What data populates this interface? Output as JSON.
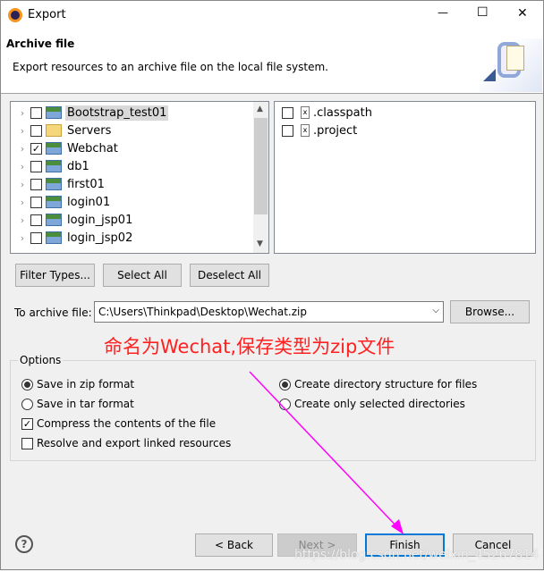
{
  "window": {
    "title": "Export",
    "minimize": "—",
    "maximize": "☐",
    "close": "✕"
  },
  "header": {
    "title": "Archive file",
    "description": "Export resources to an archive file on the local file system."
  },
  "projects": [
    {
      "label": "Bootstrap_test01",
      "checked": false,
      "icon": "java-project-icon",
      "selected": true
    },
    {
      "label": "Servers",
      "checked": false,
      "icon": "folder-icon"
    },
    {
      "label": "Webchat",
      "checked": true,
      "icon": "java-project-icon"
    },
    {
      "label": "db1",
      "checked": false,
      "icon": "java-project-icon"
    },
    {
      "label": "first01",
      "checked": false,
      "icon": "java-project-icon"
    },
    {
      "label": "login01",
      "checked": false,
      "icon": "java-project-icon"
    },
    {
      "label": "login_jsp01",
      "checked": false,
      "icon": "java-project-icon"
    },
    {
      "label": "login_jsp02",
      "checked": false,
      "icon": "java-project-icon"
    }
  ],
  "files": [
    {
      "label": ".classpath",
      "checked": false
    },
    {
      "label": ".project",
      "checked": false
    }
  ],
  "buttons": {
    "filter": "Filter Types...",
    "select_all": "Select All",
    "deselect_all": "Deselect All",
    "browse": "Browse...",
    "back": "< Back",
    "next": "Next >",
    "finish": "Finish",
    "cancel": "Cancel"
  },
  "archive": {
    "label": "To archive file:",
    "value": "C:\\Users\\Thinkpad\\Desktop\\Wechat.zip"
  },
  "annotation": "命名为Wechat,保存类型为zip文件",
  "options": {
    "title": "Options",
    "zip": "Save in zip format",
    "tar": "Save in tar format",
    "compress": "Compress the contents of the file",
    "resolve": "Resolve and export linked resources",
    "dir_structure": "Create directory structure for files",
    "selected_dirs": "Create only selected directories"
  },
  "watermark": "https://blog.csdn.net/weixin_45267814",
  "colors": {
    "annotation": "#ff2020",
    "arrow": "#ff00ff",
    "focus": "#0078d7"
  }
}
